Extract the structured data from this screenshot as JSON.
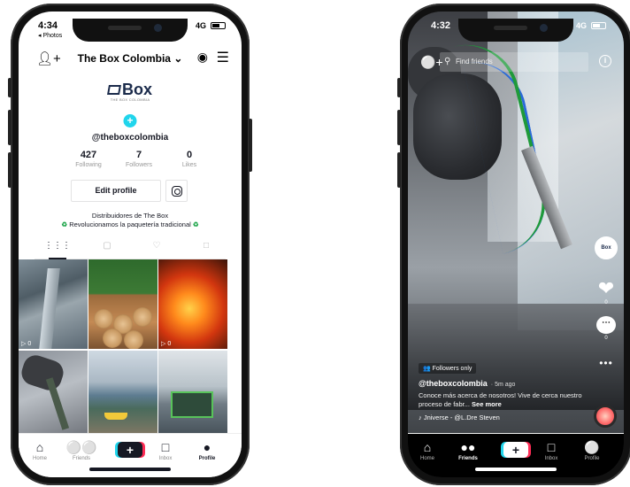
{
  "left_phone": {
    "status": {
      "time": "4:34",
      "back_label": "◂ Photos",
      "network": "4G"
    },
    "header": {
      "username": "The Box Colombia",
      "dropdown_glyph": "⌄"
    },
    "logo": {
      "word": "Box",
      "tagline": "THE BOX COLOMBIA"
    },
    "handle": "@theboxcolombia",
    "stats": [
      {
        "value": "427",
        "label": "Following"
      },
      {
        "value": "7",
        "label": "Followers"
      },
      {
        "value": "0",
        "label": "Likes"
      }
    ],
    "edit_profile_label": "Edit profile",
    "bio": {
      "line1": "Distribuidores de The Box",
      "line2": "Revolucionamos la paquetería tradicional",
      "emoji": "♻"
    },
    "tabs": [
      "videos-grid-icon",
      "lock-icon",
      "heart-icon",
      "tagged-icon"
    ],
    "videos": [
      {
        "views": "▷ 0"
      },
      {
        "views": ""
      },
      {
        "views": "▷ 0"
      },
      {
        "views": ""
      },
      {
        "views": ""
      },
      {
        "views": ""
      }
    ],
    "tabbar": [
      {
        "label": "Home"
      },
      {
        "label": "Friends"
      },
      {
        "label": "+"
      },
      {
        "label": "Inbox"
      },
      {
        "label": "Profile"
      }
    ]
  },
  "right_phone": {
    "status": {
      "time": "4:32",
      "network": "4G"
    },
    "search_placeholder": "Find friends",
    "rail": {
      "avatar_text": "Box",
      "likes": "0",
      "comments": "0"
    },
    "caption": {
      "badge": "👥 Followers only",
      "account": "@theboxcolombia",
      "ago": "· 5m ago",
      "desc": "Conoce más acerca de nosotros! Vive de cerca nuestro proceso de fabr...",
      "see_more": "See more",
      "sound": "♪  Jniverse - @L.Dre   Steven"
    },
    "tabbar": [
      {
        "label": "Home"
      },
      {
        "label": "Friends"
      },
      {
        "label": "+"
      },
      {
        "label": "Inbox"
      },
      {
        "label": "Profile"
      }
    ]
  },
  "colors": {
    "tiktok_cyan": "#20d5ec",
    "tiktok_red": "#fe2c55",
    "text_dark": "#161823",
    "recycle_green": "#1ea54a"
  }
}
